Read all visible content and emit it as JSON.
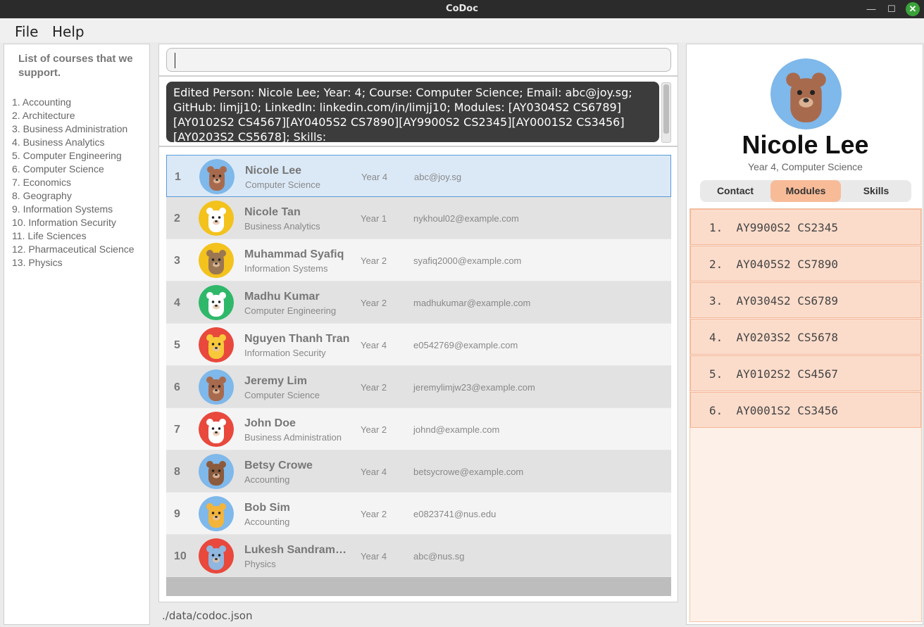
{
  "window": {
    "title": "CoDoc"
  },
  "menu": {
    "file": "File",
    "help": "Help"
  },
  "courses": {
    "title": "List of courses that we support.",
    "items": [
      "1. Accounting",
      "2. Architecture",
      "3. Business Administration",
      "4. Business Analytics",
      "5. Computer Engineering",
      "6. Computer Science",
      "7. Economics",
      "8. Geography",
      "9. Information Systems",
      "10. Information Security",
      "11. Life Sciences",
      "12. Pharmaceutical Science",
      "13. Physics"
    ]
  },
  "command": {
    "value": ""
  },
  "result": {
    "text": "Edited Person: Nicole Lee; Year: 4; Course: Computer Science; Email: abc@joy.sg; GitHub: limjj10; LinkedIn: linkedin.com/in/limjj10; Modules: [AY0304S2 CS6789][AY0102S2 CS4567][AY0405S2 CS7890][AY9900S2 CS2345][AY0001S2 CS3456][AY0203S2 CS5678]; Skills:"
  },
  "persons": [
    {
      "index": "1",
      "name": "Nicole Lee",
      "course": "Computer Science",
      "year": "Year 4",
      "email": "abc@joy.sg",
      "avatar": "bear"
    },
    {
      "index": "2",
      "name": "Nicole Tan",
      "course": "Business Analytics",
      "year": "Year 1",
      "email": "nykhoul02@example.com",
      "avatar": "panda"
    },
    {
      "index": "3",
      "name": "Muhammad Syafiq",
      "course": "Information Systems",
      "year": "Year 2",
      "email": "syafiq2000@example.com",
      "avatar": "sloth"
    },
    {
      "index": "4",
      "name": "Madhu Kumar",
      "course": "Computer Engineering",
      "year": "Year 2",
      "email": "madhukumar@example.com",
      "avatar": "chicken"
    },
    {
      "index": "5",
      "name": "Nguyen Thanh Tran",
      "course": "Information Security",
      "year": "Year 4",
      "email": "e0542769@example.com",
      "avatar": "pufferfish"
    },
    {
      "index": "6",
      "name": "Jeremy Lim",
      "course": "Computer Science",
      "year": "Year 2",
      "email": "jeremylimjw23@example.com",
      "avatar": "beaver"
    },
    {
      "index": "7",
      "name": "John Doe",
      "course": "Business Administration",
      "year": "Year 2",
      "email": "johnd@example.com",
      "avatar": "chicken-red"
    },
    {
      "index": "8",
      "name": "Betsy Crowe",
      "course": "Accounting",
      "year": "Year 4",
      "email": "betsycrowe@example.com",
      "avatar": "walrus"
    },
    {
      "index": "9",
      "name": "Bob Sim",
      "course": "Accounting",
      "year": "Year 2",
      "email": "e0823741@nus.edu",
      "avatar": "lion"
    },
    {
      "index": "10",
      "name": "Lukesh Sandramor...",
      "course": "Physics",
      "year": "Year 4",
      "email": "abc@nus.sg",
      "avatar": "hippo"
    }
  ],
  "status": {
    "path": "./data/codoc.json"
  },
  "profile": {
    "name": "Nicole Lee",
    "subtitle": "Year 4, Computer Science",
    "avatar": "bear",
    "tabs": [
      "Contact",
      "Modules",
      "Skills"
    ],
    "active_tab": "Modules",
    "modules": [
      "1.  AY9900S2 CS2345",
      "2.  AY0405S2 CS7890",
      "3.  AY0304S2 CS6789",
      "4.  AY0203S2 CS5678",
      "5.  AY0102S2 CS4567",
      "6.  AY0001S2 CS3456"
    ]
  },
  "colors": {
    "selected_row": "#dbe9f7",
    "active_tab": "#f8bb98",
    "module_row": "#fbdccb",
    "close_button": "#3aa33a"
  }
}
